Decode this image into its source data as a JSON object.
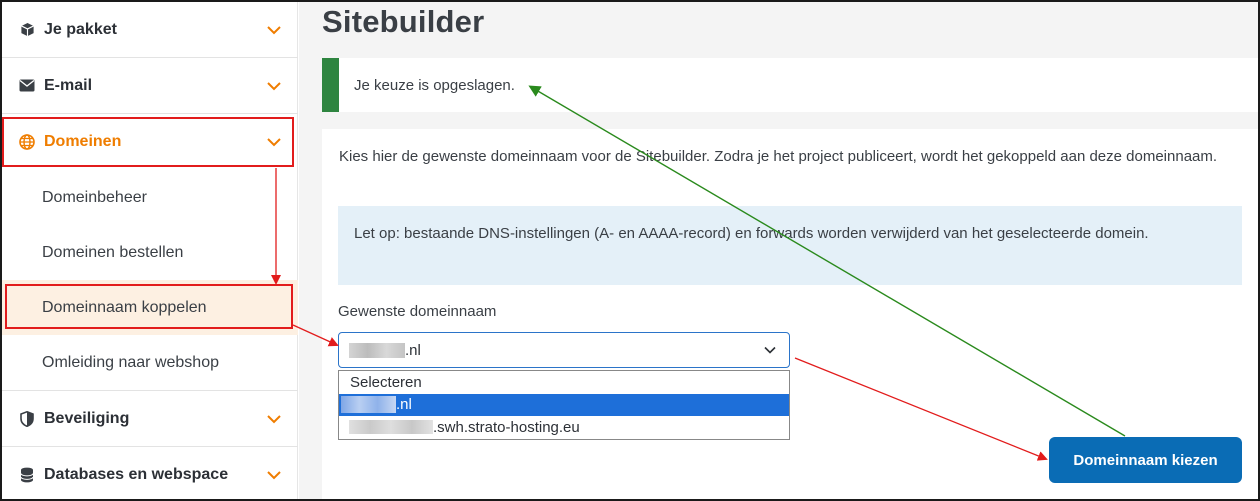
{
  "sidebar": {
    "sections": [
      {
        "label": "Je pakket",
        "icon": "box-icon"
      },
      {
        "label": "E-mail",
        "icon": "envelope-icon"
      },
      {
        "label": "Domeinen",
        "icon": "globe-icon"
      },
      {
        "label": "Beveiliging",
        "icon": "shield-icon"
      },
      {
        "label": "Databases en webspace",
        "icon": "database-icon"
      }
    ],
    "sub_items": [
      {
        "label": "Domeinbeheer"
      },
      {
        "label": "Domeinen bestellen"
      },
      {
        "label": "Domeinnaam koppelen"
      },
      {
        "label": "Omleiding naar webshop"
      }
    ]
  },
  "main": {
    "title": "Sitebuilder",
    "alert": "Je keuze is opgeslagen.",
    "description": "Kies hier de gewenste domeinnaam voor de Sitebuilder. Zodra je het project publiceert, wordt het gekoppeld aan deze domeinnaam.",
    "info": "Let op: bestaande DNS-instellingen (A- en AAAA-record) en forwards worden verwijderd van het geselecteerde domein.",
    "field_label": "Gewenste domeinnaam",
    "select_value_suffix": ".nl",
    "options": [
      {
        "text": "Selecteren"
      },
      {
        "text": ".nl"
      },
      {
        "text": ".swh.strato-hosting.eu"
      }
    ],
    "submit_label": "Domeinnaam kiezen"
  },
  "colors": {
    "accent": "#ef7d00",
    "success": "#2e8540",
    "primary": "#0a6cb5",
    "annotation_red": "#e21c1c",
    "annotation_green": "#2a8a1d"
  }
}
